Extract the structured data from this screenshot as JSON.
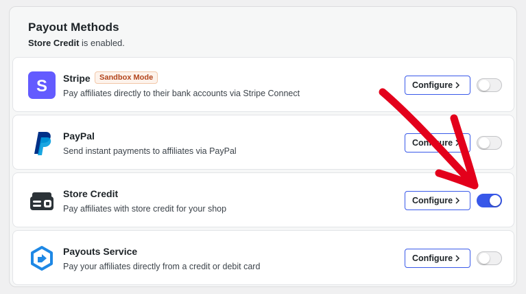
{
  "header": {
    "title": "Payout Methods",
    "status_strong": "Store Credit",
    "status_rest": " is enabled."
  },
  "methods": [
    {
      "name": "Stripe",
      "badge": "Sandbox Mode",
      "description": "Pay affiliates directly to their bank accounts via Stripe Connect",
      "configure_label": "Configure",
      "enabled": false,
      "icon": "stripe-logo"
    },
    {
      "name": "PayPal",
      "description": "Send instant payments to affiliates via PayPal",
      "configure_label": "Configure",
      "enabled": false,
      "icon": "paypal-logo"
    },
    {
      "name": "Store Credit",
      "description": "Pay affiliates with store credit for your shop",
      "configure_label": "Configure",
      "enabled": true,
      "icon": "store-credit-icon"
    },
    {
      "name": "Payouts Service",
      "description": "Pay your affiliates directly from a credit or debit card",
      "configure_label": "Configure",
      "enabled": false,
      "icon": "payouts-service-icon"
    }
  ],
  "colors": {
    "accent": "#3858e9",
    "stripe": "#635bff",
    "paypal_dark": "#003087",
    "paypal_light": "#009cde",
    "annotation_arrow": "#e3001b"
  }
}
